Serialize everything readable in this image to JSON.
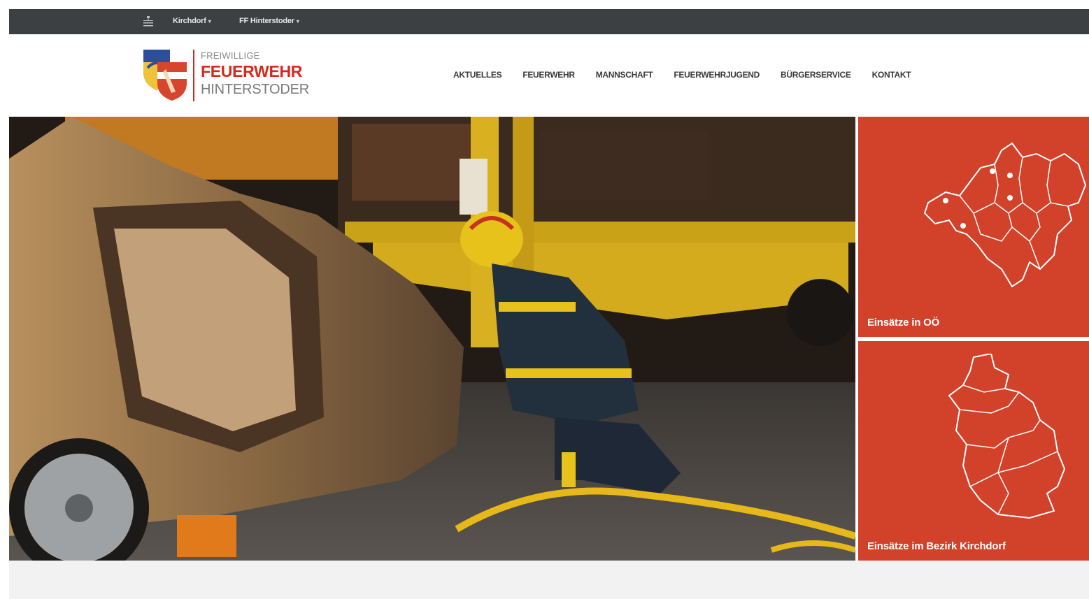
{
  "topbar": {
    "sitemap_icon": "sitemap-icon",
    "dropdown1": "Kirchdorf",
    "dropdown2": "FF Hinterstoder"
  },
  "logo": {
    "line1": "FREIWILLIGE",
    "line2": "FEUERWEHR",
    "line3": "HINTERSTODER"
  },
  "nav": {
    "items": [
      "AKTUELLES",
      "FEUERWEHR",
      "MANNSCHAFT",
      "FEUERWEHRJUGEND",
      "BÜRGERSERVICE",
      "KONTAKT"
    ]
  },
  "tiles": {
    "upper_austria": "Einsätze in OÖ",
    "district": "Einsätze im Bezirk Kirchdorf"
  },
  "colors": {
    "topbar": "#3c4043",
    "brand_red": "#d42a1c",
    "tile_red": "#d2412a"
  }
}
